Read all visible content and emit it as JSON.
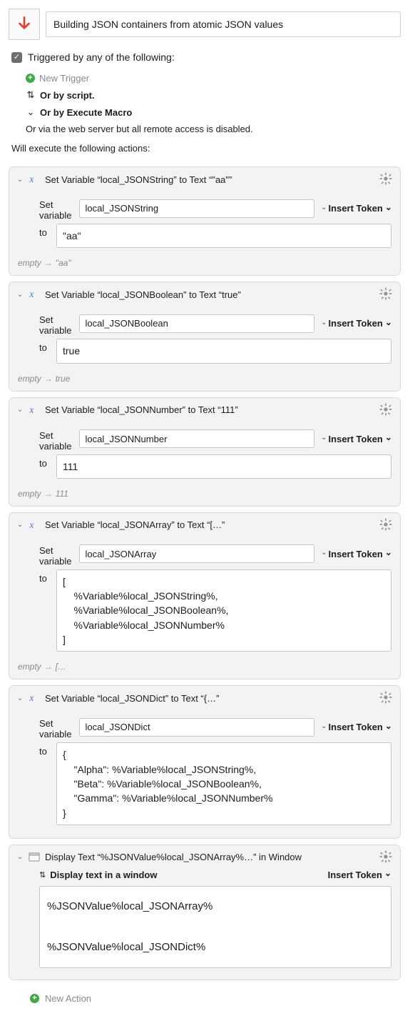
{
  "header": {
    "title": "Building JSON containers from atomic JSON values"
  },
  "trigger": {
    "label": "Triggered by any of the following:",
    "new_trigger": "New Trigger",
    "by_script": "Or by script.",
    "by_execute_macro": "Or by Execute Macro",
    "web_server_note": "Or via the web server but all remote access is disabled."
  },
  "exec_lead": "Will execute the following actions:",
  "labels": {
    "set_variable": "Set variable",
    "to": "to",
    "insert_token": "Insert Token",
    "empty": "empty"
  },
  "actions": [
    {
      "title": "Set Variable “local_JSONString” to Text “\"aa\"”",
      "var_name": "local_JSONString",
      "value": "\"aa\"",
      "preview": "\"aa\""
    },
    {
      "title": "Set Variable “local_JSONBoolean” to Text “true”",
      "var_name": "local_JSONBoolean",
      "value": "true",
      "preview": "true"
    },
    {
      "title": "Set Variable “local_JSONNumber” to Text “111”",
      "var_name": "local_JSONNumber",
      "value": "111",
      "preview": "111"
    },
    {
      "title": "Set Variable “local_JSONArray” to Text “[…”",
      "var_name": "local_JSONArray",
      "value": "[\n    %Variable%local_JSONString%,\n    %Variable%local_JSONBoolean%,\n    %Variable%local_JSONNumber%\n]",
      "preview": "[…"
    },
    {
      "title": "Set Variable “local_JSONDict” to Text “{…”",
      "var_name": "local_JSONDict",
      "value": "{\n    \"Alpha\": %Variable%local_JSONString%,\n    \"Beta\": %Variable%local_JSONBoolean%,\n    \"Gamma\": %Variable%local_JSONNumber%\n}",
      "preview": null
    }
  ],
  "display_action": {
    "title": "Display Text “%JSONValue%local_JSONArray%…” in Window",
    "subtitle": "Display text in a window",
    "body": "%JSONValue%local_JSONArray%\n\n%JSONValue%local_JSONDict%"
  },
  "new_action": "New Action"
}
